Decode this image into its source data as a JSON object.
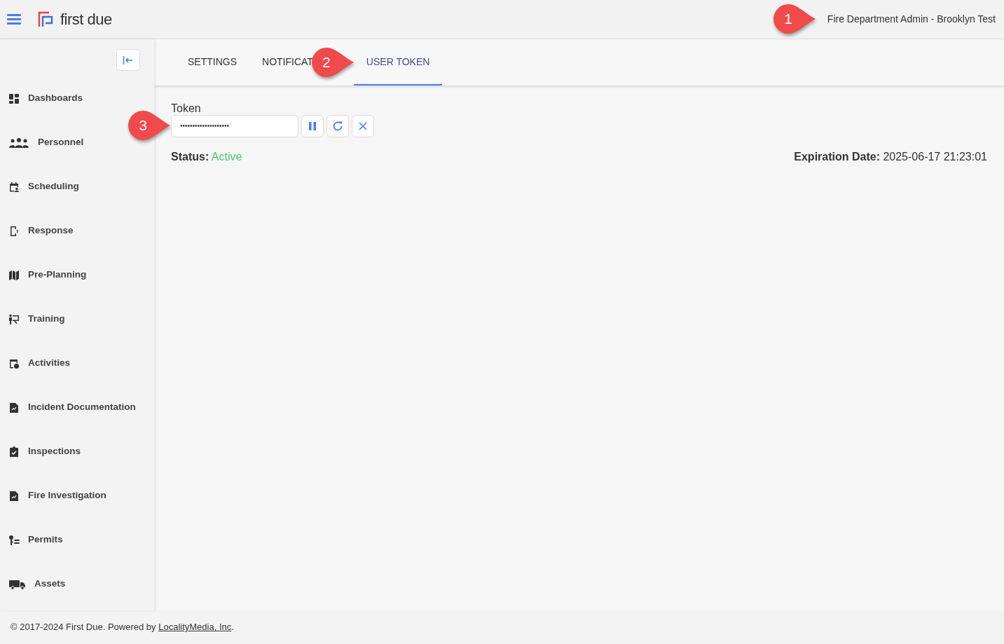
{
  "header": {
    "logo_text": "first due",
    "account": "Fire Department Admin - Brooklyn Test"
  },
  "sidebar": {
    "items": [
      {
        "label": "Dashboards"
      },
      {
        "label": "Personnel"
      },
      {
        "label": "Scheduling"
      },
      {
        "label": "Response"
      },
      {
        "label": "Pre-Planning"
      },
      {
        "label": "Training"
      },
      {
        "label": "Activities"
      },
      {
        "label": "Incident Documentation"
      },
      {
        "label": "Inspections"
      },
      {
        "label": "Fire Investigation"
      },
      {
        "label": "Permits"
      },
      {
        "label": "Assets"
      }
    ]
  },
  "tabs": [
    {
      "label": "SETTINGS",
      "selected": false
    },
    {
      "label": "NOTIFICAT",
      "selected": false
    },
    {
      "label": "USER TOKEN",
      "selected": true
    }
  ],
  "token": {
    "label": "Token",
    "value": "••••••••••••••••••••",
    "status_label": "Status:",
    "status": "Active",
    "expiration_label": "Expiration Date:",
    "expiration": "2025-06-17 21:23:01"
  },
  "footer": {
    "text": "© 2017-2024 First Due. Powered by ",
    "link": "LocalityMedia, Inc",
    "end": "."
  },
  "callouts": [
    "1",
    "2",
    "3"
  ]
}
